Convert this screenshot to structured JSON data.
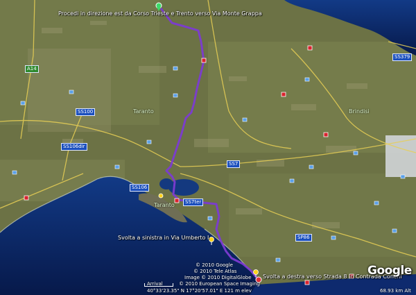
{
  "map": {
    "directions": {
      "start": "Procedi in direzione est da Corso Trieste e Trento verso Via Monte Grappa",
      "turn_left": "Svolta a sinistra in Via Umberto I",
      "turn_right": "Svolta a destra verso Strada 8 in Contrada Conchi"
    },
    "places": {
      "taranto_region": "Taranto",
      "taranto_city": "Taranto",
      "brindisi": "Brindisi"
    },
    "road_shields": {
      "a14": "A14",
      "ss100": "SS100",
      "ss106dir": "SS106dir",
      "ss106": "SS106",
      "ss7": "SS7",
      "ss7ter": "SS7ter",
      "sp86": "SP86",
      "ss379": "SS379"
    },
    "copyright": {
      "line1": "© 2010 Google",
      "line2": "© 2010 Tele Atlas",
      "line3": "Image © 2010 DigitalGlobe",
      "line4": "© 2010 European Space Imaging"
    },
    "scale_label": "Arrival ",
    "status": {
      "coords": "40°33'23.35\" N     17°20'57.01\" E     121 m elev",
      "eye_alt": "68.93 km Alt"
    },
    "logo": "Google",
    "colors": {
      "route": "#7c3bd1",
      "sea": "#0e2a6e",
      "land": "#6f7446",
      "shield": "#1b4fbd"
    }
  }
}
